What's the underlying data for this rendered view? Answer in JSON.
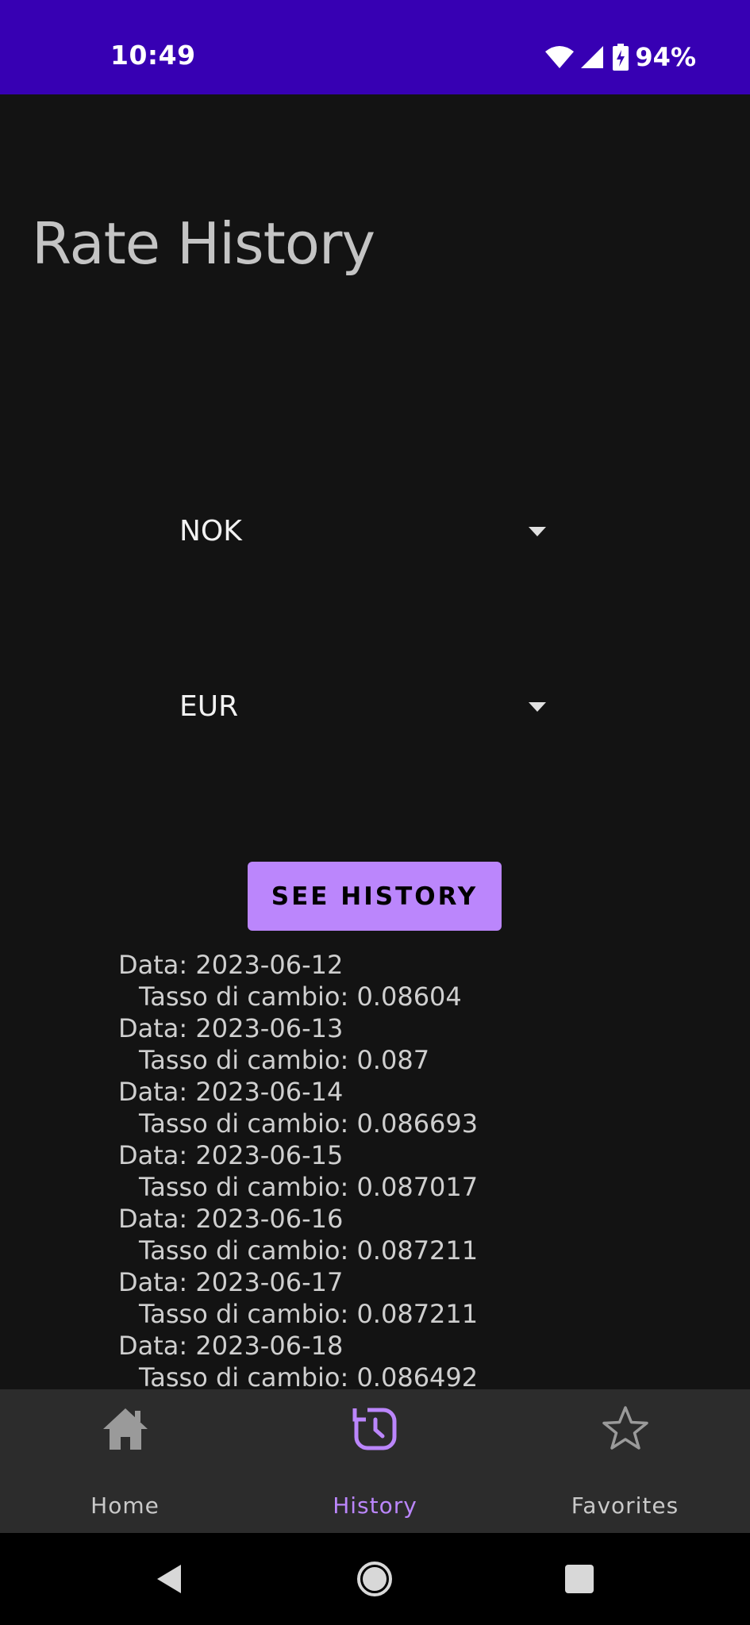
{
  "status_bar": {
    "time": "10:49",
    "battery": "94%",
    "icons": [
      "wifi-icon",
      "signal-icon",
      "battery-charging-icon"
    ],
    "background": "#3700b3"
  },
  "page": {
    "title": "Rate History"
  },
  "dropdowns": {
    "from": {
      "value": "NOK",
      "icon": "dropdown-arrow-icon"
    },
    "to": {
      "value": "EUR",
      "icon": "dropdown-arrow-icon"
    }
  },
  "actions": {
    "see_history_label": "SEE HISTORY",
    "accent": "#bb86fc"
  },
  "history": [
    {
      "date": "Data: 2023-06-12",
      "rate": "Tasso di cambio: 0.08604"
    },
    {
      "date": "Data: 2023-06-13",
      "rate": "Tasso di cambio: 0.087"
    },
    {
      "date": "Data: 2023-06-14",
      "rate": "Tasso di cambio: 0.086693"
    },
    {
      "date": "Data: 2023-06-15",
      "rate": "Tasso di cambio: 0.087017"
    },
    {
      "date": "Data: 2023-06-16",
      "rate": "Tasso di cambio: 0.087211"
    },
    {
      "date": "Data: 2023-06-17",
      "rate": "Tasso di cambio: 0.087211"
    },
    {
      "date": "Data: 2023-06-18",
      "rate": "Tasso di cambio: 0.086492"
    }
  ],
  "bottom_nav": {
    "items": [
      {
        "label": "Home",
        "icon": "home-icon",
        "active": false
      },
      {
        "label": "History",
        "icon": "history-icon",
        "active": true
      },
      {
        "label": "Favorites",
        "icon": "star-icon",
        "active": false
      }
    ]
  },
  "system_nav": {
    "icons": [
      "back-icon",
      "home-circle-icon",
      "recents-icon"
    ]
  }
}
